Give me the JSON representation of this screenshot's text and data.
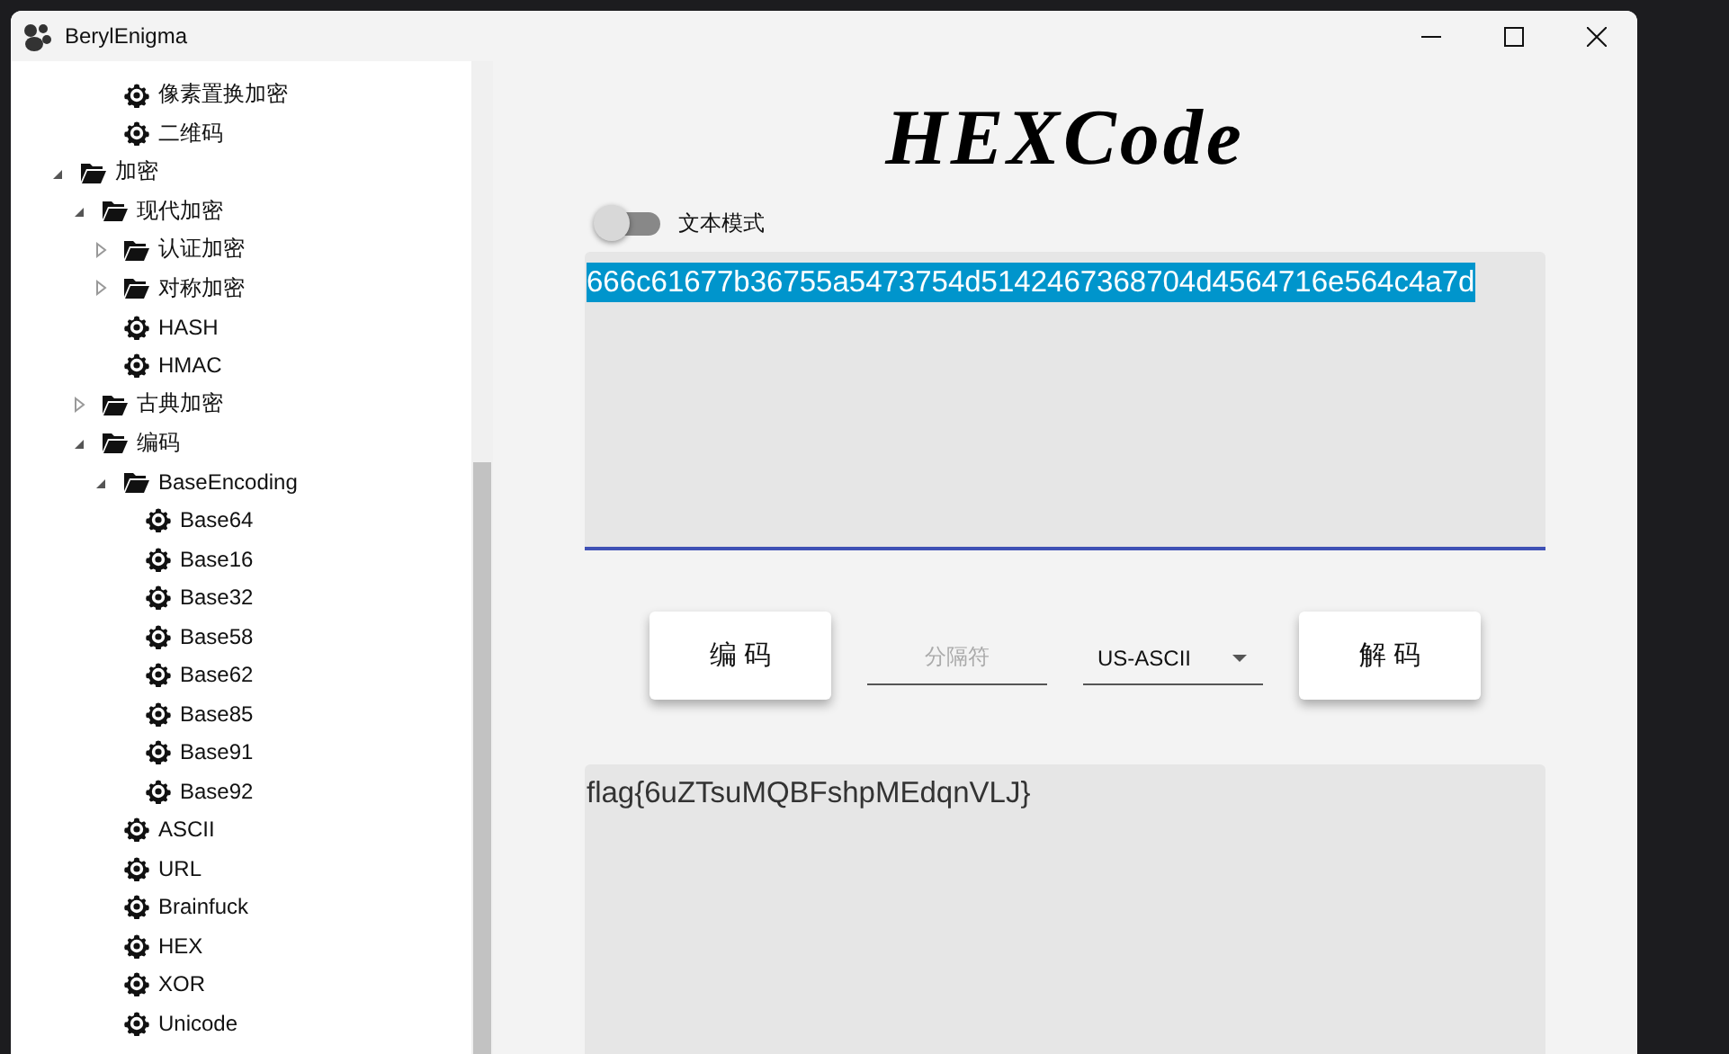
{
  "window": {
    "title": "BerylEnigma"
  },
  "tree": [
    {
      "kind": "group",
      "children": [
        {
          "kind": "group",
          "children": [
            {
              "kind": "leaf",
              "label": "像素置换加密"
            },
            {
              "kind": "leaf",
              "label": "二维码"
            }
          ]
        }
      ]
    },
    {
      "kind": "folder",
      "label": "加密",
      "expanded": true,
      "children": [
        {
          "kind": "folder",
          "label": "现代加密",
          "expanded": true,
          "children": [
            {
              "kind": "folder",
              "label": "认证加密",
              "expanded": false
            },
            {
              "kind": "folder",
              "label": "对称加密",
              "expanded": false
            },
            {
              "kind": "leaf",
              "label": "HASH"
            },
            {
              "kind": "leaf",
              "label": "HMAC"
            }
          ]
        },
        {
          "kind": "folder",
          "label": "古典加密",
          "expanded": false
        },
        {
          "kind": "folder",
          "label": "编码",
          "expanded": true,
          "children": [
            {
              "kind": "folder",
              "label": "BaseEncoding",
              "expanded": true,
              "children": [
                {
                  "kind": "leaf",
                  "label": "Base64"
                },
                {
                  "kind": "leaf",
                  "label": "Base16"
                },
                {
                  "kind": "leaf",
                  "label": "Base32"
                },
                {
                  "kind": "leaf",
                  "label": "Base58"
                },
                {
                  "kind": "leaf",
                  "label": "Base62"
                },
                {
                  "kind": "leaf",
                  "label": "Base85"
                },
                {
                  "kind": "leaf",
                  "label": "Base91"
                },
                {
                  "kind": "leaf",
                  "label": "Base92"
                }
              ]
            },
            {
              "kind": "leaf",
              "label": "ASCII"
            },
            {
              "kind": "leaf",
              "label": "URL"
            },
            {
              "kind": "leaf",
              "label": "Brainfuck"
            },
            {
              "kind": "leaf",
              "label": "HEX"
            },
            {
              "kind": "leaf",
              "label": "XOR"
            },
            {
              "kind": "leaf",
              "label": "Unicode"
            }
          ]
        }
      ]
    }
  ],
  "page": {
    "title": "HEXCode",
    "text_mode": {
      "label": "文本模式",
      "on": false
    },
    "input": {
      "value": "666c61677b36755a5473754d5142467368704d4564716e564c4a7d",
      "selected": true
    },
    "encode_button": "编 码",
    "separator": {
      "placeholder": "分隔符"
    },
    "charset": {
      "value": "US-ASCII"
    },
    "decode_button": "解 码",
    "output": {
      "value": "flag{6uZTsuMQBFshpMEdqnVLJ}"
    }
  }
}
